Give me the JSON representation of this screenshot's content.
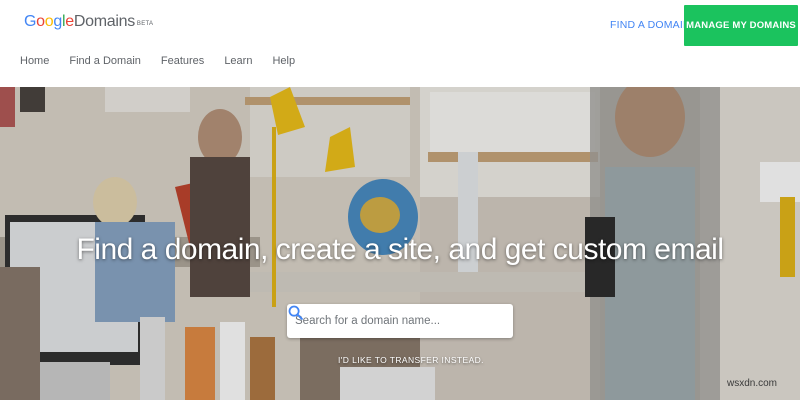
{
  "header": {
    "logo_google": "Google",
    "logo_domains": "Domains",
    "logo_badge": "BETA",
    "find_domain_link": "FIND A DOMAIN",
    "manage_button": "MANAGE MY DOMAINS",
    "nav": [
      {
        "label": "Home"
      },
      {
        "label": "Find a Domain"
      },
      {
        "label": "Features"
      },
      {
        "label": "Learn"
      },
      {
        "label": "Help"
      }
    ]
  },
  "hero": {
    "headline": "Find a domain, create a site, and get custom email",
    "search": {
      "placeholder": "Search for a domain name...",
      "value": ""
    },
    "transfer_link": "I'D LIKE TO TRANSFER INSTEAD."
  },
  "watermark": "wsxdn.com",
  "colors": {
    "brand_blue": "#4285f4",
    "manage_button_green": "#1bc35e",
    "nav_text": "#5f6368"
  },
  "icons": [
    "search-icon"
  ]
}
